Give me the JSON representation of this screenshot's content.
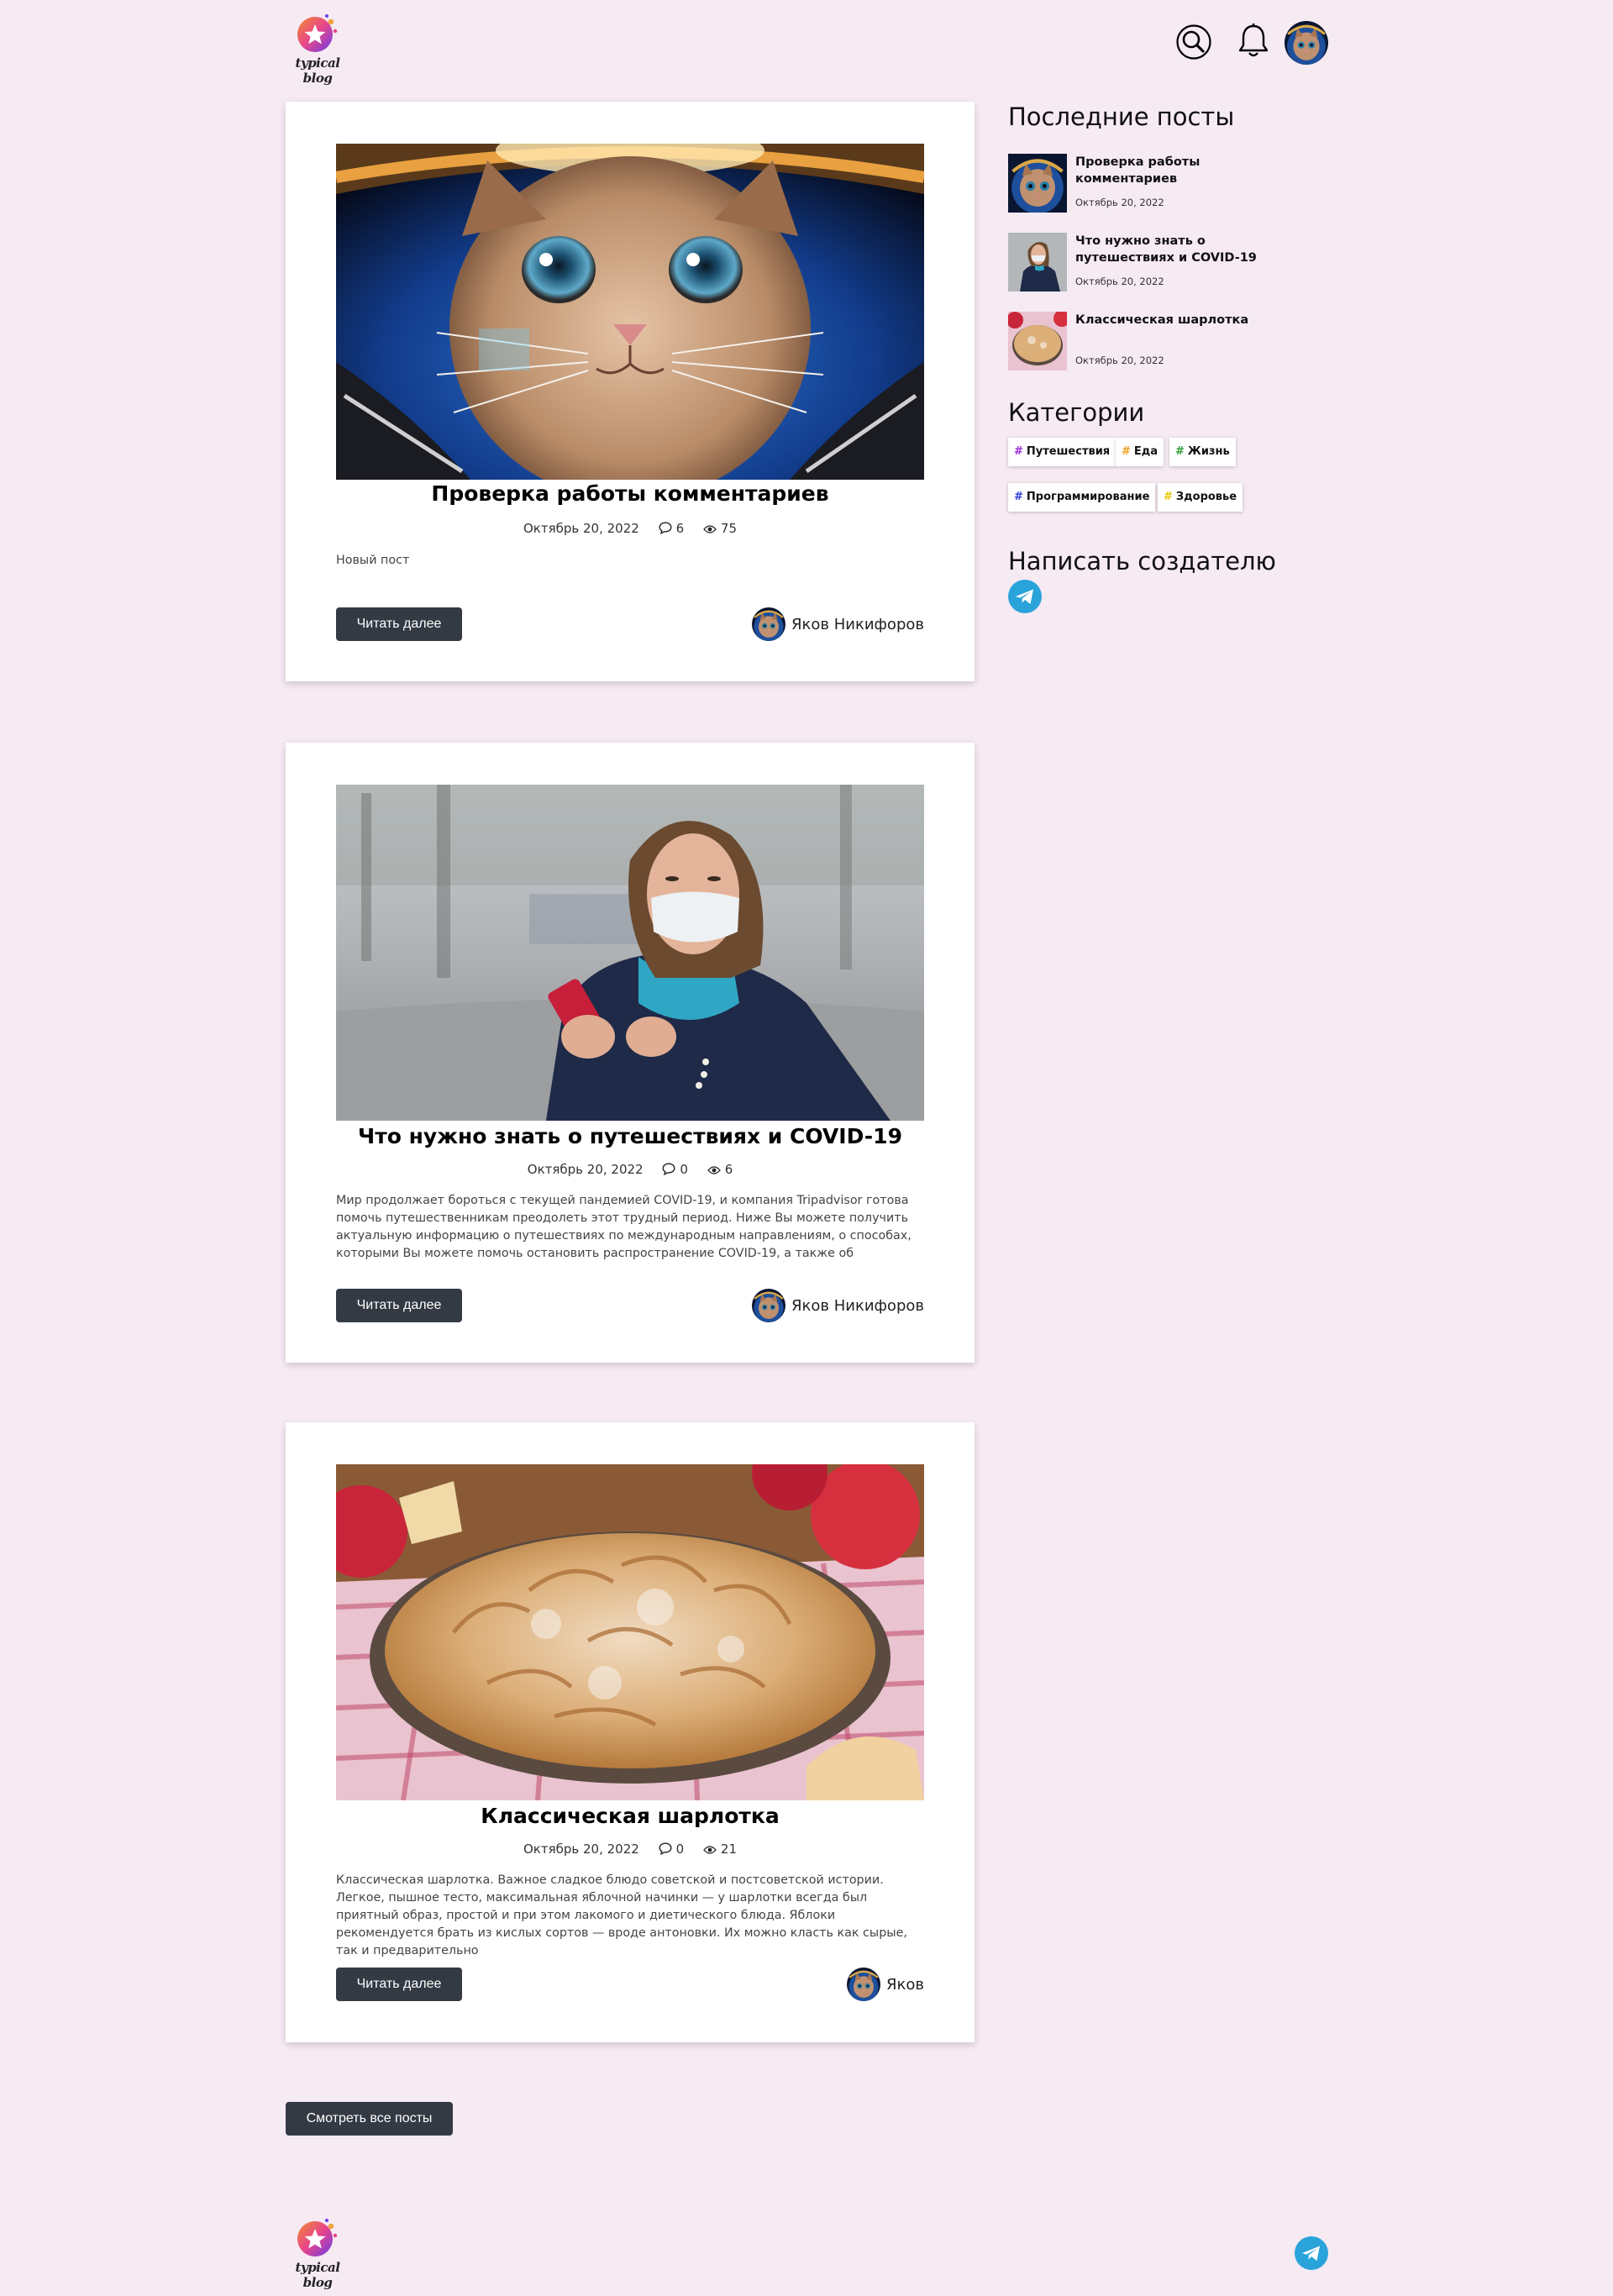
{
  "header": {
    "logo_text": "typical blog",
    "search_icon": "search-icon",
    "bell_icon": "bell-icon",
    "avatar": "user-avatar-cat-astronaut"
  },
  "posts": [
    {
      "title": "Проверка работы комментариев",
      "date": "Октябрь 20, 2022",
      "comments": "6",
      "views": "75",
      "excerpt": "Новый пост",
      "read_more": "Читать далее",
      "author": "Яков Никифоров",
      "image": "cat-astronaut"
    },
    {
      "title": "Что нужно знать о путешествиях и COVID-19",
      "date": "Октябрь 20, 2022",
      "comments": "0",
      "views": "6",
      "excerpt": "Мир продолжает бороться с текущей пандемией COVID-19, и компания Tripadvisor готова помочь путешественникам преодолеть этот трудный период. Ниже Вы можете получить актуальную информацию о путешествиях по международным направлениям, о способах, которыми Вы можете помочь остановить распространение COVID-19, а также об",
      "read_more": "Читать далее",
      "author": "Яков Никифоров",
      "image": "woman-in-mask-with-phone"
    },
    {
      "title": "Классическая шарлотка",
      "date": "Октябрь 20, 2022",
      "comments": "0",
      "views": "21",
      "excerpt": "Классическая шарлотка. Важное сладкое блюдо советской и постсоветской истории. Легкое, пышное тесто, максимальная яблочной начинки — у шарлотки всегда был приятный образ, простой и при этом лакомого и диетического блюда. Яблоки рекомендуется брать из кислых сортов — вроде антоновки. Их можно класть как сырые, так и предварительно",
      "read_more": "Читать далее",
      "author": "Яков",
      "image": "apple-pie"
    }
  ],
  "all_posts_button": "Смотреть все посты",
  "sidebar": {
    "recent_heading": "Последние посты",
    "recent": [
      {
        "title": "Проверка работы комментариев",
        "date": "Октябрь 20, 2022"
      },
      {
        "title": "Что нужно знать о путешествиях и COVID-19",
        "date": "Октябрь 20, 2022"
      },
      {
        "title": "Классическая шарлотка",
        "date": "Октябрь 20, 2022"
      }
    ],
    "categories_heading": "Категории",
    "categories": [
      {
        "label": "Путешествия",
        "hash": "#",
        "color": "#9b2fd9"
      },
      {
        "label": "Еда",
        "hash": "#",
        "color": "#f0a020"
      },
      {
        "label": "Жизнь",
        "hash": "#",
        "color": "#2e9e3a"
      },
      {
        "label": "Программирование",
        "hash": "#",
        "color": "#2f3fd9"
      },
      {
        "label": "Здоровье",
        "hash": "#",
        "color": "#e6c800"
      }
    ],
    "contact_heading": "Написать создателю",
    "contact_icon": "telegram-icon"
  },
  "footer": {
    "logo_text": "typical blog",
    "telegram_icon": "telegram-icon"
  },
  "colors": {
    "background": "#f6eaf3",
    "button": "#343a44",
    "telegram": "#2aa3db"
  }
}
